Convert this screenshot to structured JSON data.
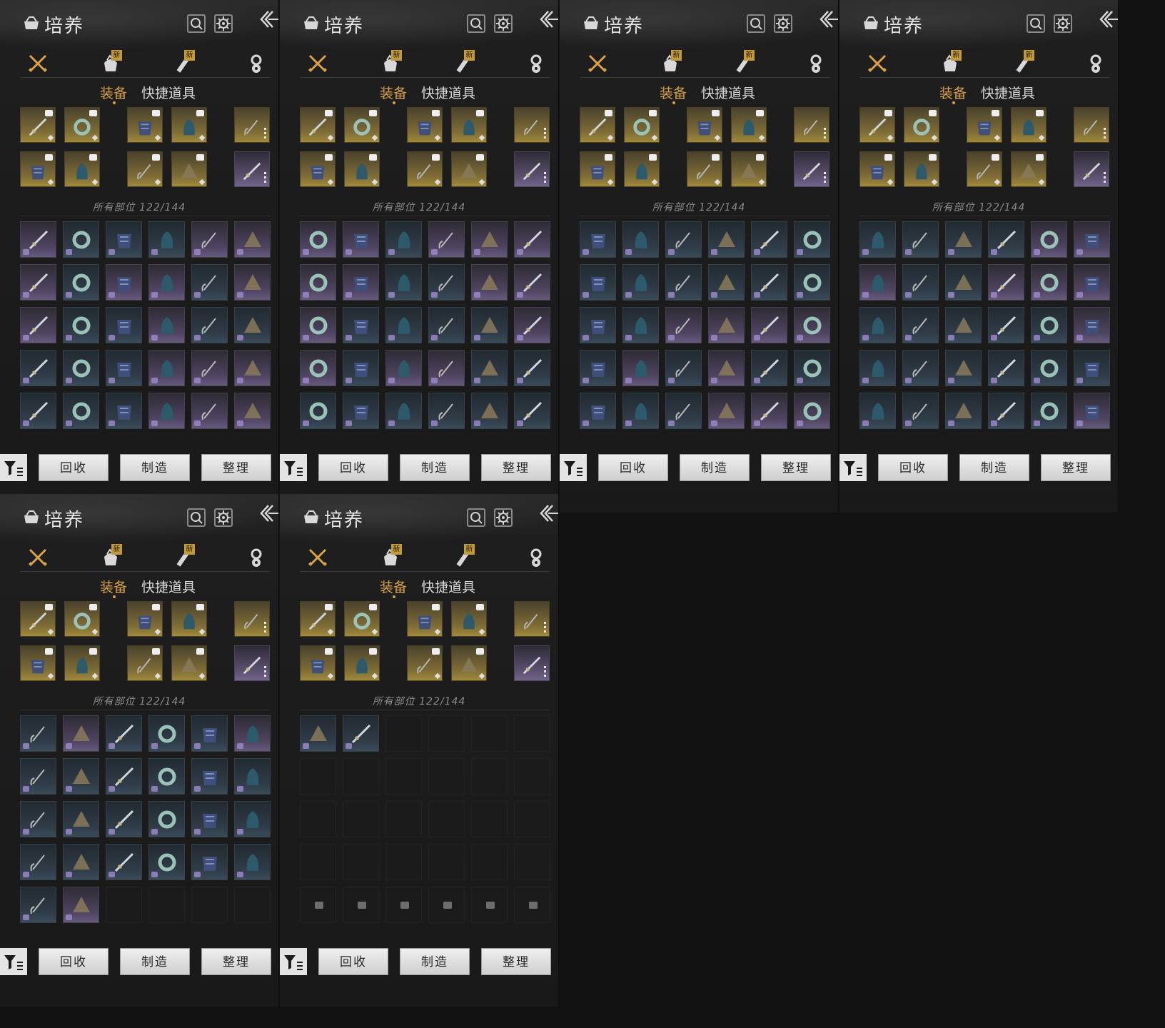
{
  "panels": [
    {
      "inv_rows": [
        [
          "p",
          "g",
          "g",
          "g",
          "p",
          "p"
        ],
        [
          "p",
          "g",
          "p",
          "p",
          "g",
          "p"
        ],
        [
          "p",
          "g",
          "g",
          "p",
          "g",
          "g"
        ],
        [
          "g",
          "g",
          "g",
          "p",
          "p",
          "p"
        ],
        [
          "g",
          "g",
          "g",
          "p",
          "p",
          "p"
        ]
      ]
    },
    {
      "inv_rows": [
        [
          "p",
          "p",
          "g",
          "p",
          "p",
          "p"
        ],
        [
          "p",
          "p",
          "g",
          "g",
          "p",
          "p"
        ],
        [
          "p",
          "g",
          "g",
          "g",
          "g",
          "p"
        ],
        [
          "p",
          "g",
          "p",
          "p",
          "g",
          "g"
        ],
        [
          "g",
          "g",
          "g",
          "g",
          "g",
          "g"
        ]
      ]
    },
    {
      "inv_rows": [
        [
          "g",
          "g",
          "g",
          "g",
          "g",
          "g"
        ],
        [
          "g",
          "g",
          "g",
          "g",
          "g",
          "g"
        ],
        [
          "g",
          "g",
          "p",
          "p",
          "p",
          "p"
        ],
        [
          "g",
          "p",
          "g",
          "p",
          "g",
          "g"
        ],
        [
          "g",
          "g",
          "g",
          "p",
          "p",
          "p"
        ]
      ]
    },
    {
      "inv_rows": [
        [
          "g",
          "g",
          "g",
          "g",
          "p",
          "p"
        ],
        [
          "p",
          "g",
          "g",
          "p",
          "p",
          "p"
        ],
        [
          "g",
          "g",
          "g",
          "g",
          "g",
          "p"
        ],
        [
          "g",
          "g",
          "g",
          "g",
          "g",
          "g"
        ],
        [
          "g",
          "g",
          "g",
          "g",
          "g",
          "p"
        ]
      ]
    },
    {
      "inv_rows": [
        [
          "g",
          "p",
          "g",
          "g",
          "g",
          "p"
        ],
        [
          "g",
          "g",
          "g",
          "g",
          "g",
          "g"
        ],
        [
          "g",
          "g",
          "g",
          "g",
          "g",
          "g"
        ],
        [
          "g",
          "g",
          "g",
          "g",
          "g",
          "g"
        ],
        [
          "g",
          "p",
          "e",
          "e",
          "e",
          "e"
        ]
      ]
    },
    {
      "inv_rows": [
        [
          "g",
          "g",
          "e",
          "e",
          "e",
          "e"
        ],
        [
          "e",
          "e",
          "e",
          "e",
          "e",
          "e"
        ],
        [
          "e",
          "e",
          "e",
          "e",
          "e",
          "e"
        ],
        [
          "e",
          "e",
          "e",
          "e",
          "e",
          "e"
        ],
        [
          "lock",
          "lock",
          "lock",
          "lock",
          "lock",
          "lock"
        ]
      ]
    }
  ],
  "header": {
    "title": "培养",
    "icons": [
      "bag-icon",
      "search-icon",
      "settings-icon",
      "back-icon"
    ]
  },
  "tabs": {
    "items": [
      {
        "icon": "crossed-swords-icon",
        "badge": ""
      },
      {
        "icon": "pouch-icon",
        "badge": "新"
      },
      {
        "icon": "scroll-icon",
        "badge": "新"
      },
      {
        "icon": "spirit-icon",
        "badge": ""
      }
    ]
  },
  "subtabs": {
    "equipment": "装备",
    "quick_items": "快捷道具"
  },
  "equipped": {
    "slots_top": [
      "gold",
      "gold",
      "gold",
      "gold",
      "gold"
    ],
    "slots_bottom": [
      "gold",
      "gold",
      "gold",
      "gold",
      "purple"
    ]
  },
  "capacity": "所有部位 122/144",
  "bottom": {
    "recycle": "回收",
    "craft": "制造",
    "organize": "整理"
  },
  "colors": {
    "accent": "#d9a245",
    "gold_slot": "#8a7638",
    "purple_slot": "#5d5372",
    "steel_slot": "#2f3b47"
  }
}
